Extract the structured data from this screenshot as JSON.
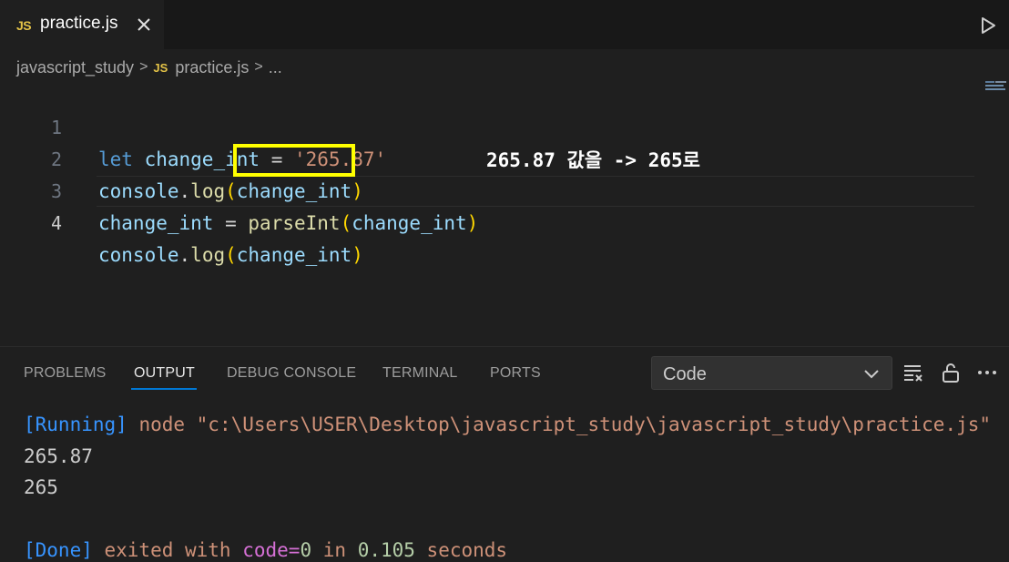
{
  "tab": {
    "badge": "JS",
    "title": "practice.js",
    "close_icon": "close-icon"
  },
  "run_icon": "play-icon",
  "breadcrumb": {
    "folder": "javascript_study",
    "badge": "JS",
    "file": "practice.js",
    "more": "..."
  },
  "editor": {
    "lines": [
      {
        "number": "1",
        "tokens": [
          "let",
          "change_int",
          "=",
          "'265.87'"
        ]
      },
      {
        "number": "2",
        "tokens": [
          "console",
          ".",
          "log",
          "(",
          "change_int",
          ")"
        ]
      },
      {
        "number": "3",
        "tokens": [
          "change_int",
          "=",
          "parseInt",
          "(",
          "change_int",
          ")"
        ]
      },
      {
        "number": "4",
        "tokens": [
          "console",
          ".",
          "log",
          "(",
          "change_int",
          ")"
        ]
      }
    ],
    "annotation": "265.87 값을 -> 265로"
  },
  "panel": {
    "tabs": [
      "PROBLEMS",
      "OUTPUT",
      "DEBUG CONSOLE",
      "TERMINAL",
      "PORTS"
    ],
    "active_tab": "OUTPUT",
    "dropdown_value": "Code",
    "icons": [
      "clear-output-icon",
      "unlock-icon",
      "more-icon"
    ],
    "output": {
      "running_tag": "[Running]",
      "running_cmd": " node \"c:\\Users\\USER\\Desktop\\javascript_study\\javascript_study\\practice.js\"",
      "result1": "265.87",
      "result2": "265",
      "done_tag": "[Done]",
      "done_text1": " exited with ",
      "done_code_label": "code=",
      "done_code_value": "0",
      "done_text2": " in ",
      "done_time": "0.105",
      "done_text3": " seconds"
    }
  },
  "colors": {
    "accent": "#0078d4",
    "highlight": "#ffff00",
    "background": "#1f1f1f"
  }
}
